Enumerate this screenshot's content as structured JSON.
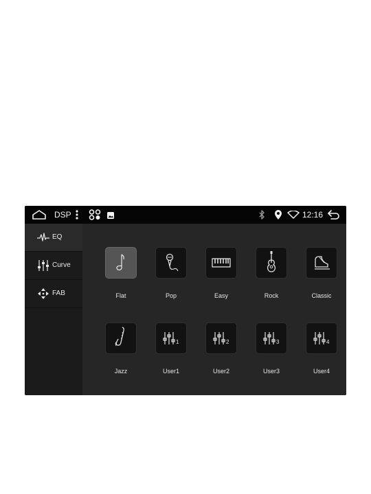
{
  "statusbar": {
    "app_label": "DSP",
    "time": "12:16",
    "icons": [
      "home-icon",
      "more-vert-icon",
      "apps-icon",
      "gallery-icon",
      "bluetooth-icon",
      "location-icon",
      "wifi-icon",
      "back-icon"
    ]
  },
  "sidebar": {
    "items": [
      {
        "label": "EQ",
        "icon": "waveform-icon",
        "active": true
      },
      {
        "label": "Curve",
        "icon": "sliders-icon",
        "active": false
      },
      {
        "label": "FAB",
        "icon": "balance-arrows-icon",
        "active": false
      }
    ]
  },
  "presets": [
    {
      "label": "Flat",
      "icon": "music-note-icon",
      "selected": true
    },
    {
      "label": "Pop",
      "icon": "microphone-icon",
      "selected": false
    },
    {
      "label": "Easy",
      "icon": "keyboard-icon",
      "selected": false
    },
    {
      "label": "Rock",
      "icon": "guitar-icon",
      "selected": false
    },
    {
      "label": "Classic",
      "icon": "piano-icon",
      "selected": false
    },
    {
      "label": "Jazz",
      "icon": "saxophone-icon",
      "selected": false
    },
    {
      "label": "User1",
      "icon": "eq-sliders-icon",
      "badge": "1",
      "selected": false
    },
    {
      "label": "User2",
      "icon": "eq-sliders-icon",
      "badge": "2",
      "selected": false
    },
    {
      "label": "User3",
      "icon": "eq-sliders-icon",
      "badge": "3",
      "selected": false
    },
    {
      "label": "User4",
      "icon": "eq-sliders-icon",
      "badge": "4",
      "selected": false
    }
  ],
  "colors": {
    "background": "#262626",
    "sidebar": "#1b1b1b",
    "tile": "#121212",
    "tile_selected": "#555555"
  }
}
